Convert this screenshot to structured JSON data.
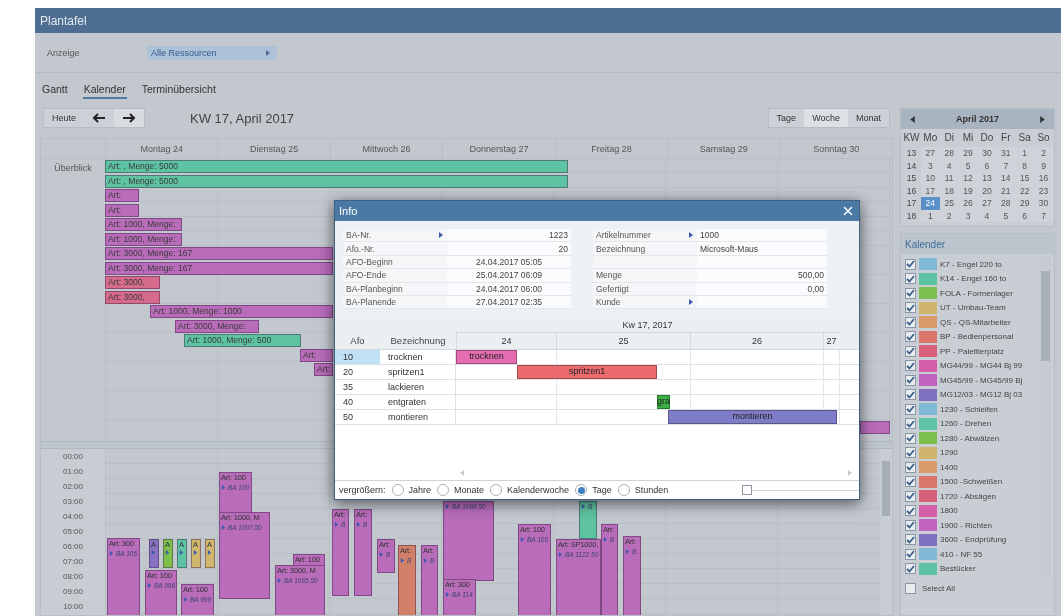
{
  "window": {
    "title": "Plantafel"
  },
  "filter": {
    "label": "Anzeige",
    "value": "Alle Ressourcen"
  },
  "tabs": [
    {
      "label": "Gantt",
      "selected": false
    },
    {
      "label": "Kalender",
      "selected": true
    },
    {
      "label": "Terminübersicht",
      "selected": false
    }
  ],
  "toolbar": {
    "today": "Heute",
    "period": "KW 17, April 2017",
    "views": [
      {
        "label": "Tage",
        "selected": false
      },
      {
        "label": "Woche",
        "selected": true
      },
      {
        "label": "Monat",
        "selected": false
      }
    ]
  },
  "days": [
    "Montag 24",
    "Dienstag 25",
    "Mittwoch 26",
    "Donnerstag 27",
    "Freitag 28",
    "Samstag 29",
    "Sonntag 30"
  ],
  "overview": {
    "label": "Überblick",
    "bars": [
      {
        "label": "Art: , Menge: 5000",
        "color": "#5ec3a2"
      },
      {
        "label": "Art: , Menge: 5000",
        "color": "#5ec3a2"
      },
      {
        "label": "Art:",
        "color": "#b86cba"
      },
      {
        "label": "Art:",
        "color": "#b86cba"
      },
      {
        "label": "Art: 1000, Menge:",
        "color": "#b86cba"
      },
      {
        "label": "Art: 1000, Menge:",
        "color": "#b86cba"
      },
      {
        "label": "Art: 3000, Menge: 167",
        "color": "#b86cba"
      },
      {
        "label": "Art: 3000, Menge: 167",
        "color": "#b86cba"
      },
      {
        "label": "Art: 3000,",
        "color": "#d66a8a"
      },
      {
        "label": "Art: 3000,",
        "color": "#d66a8a"
      },
      {
        "label": "Art: 1000, Menge: 1000",
        "color": "#b86cba"
      },
      {
        "label": "Art: 3000, Menge:",
        "color": "#b86cba"
      },
      {
        "label": "Art: 1000, Menge: 500",
        "color": "#5ec3a2"
      },
      {
        "label": "Art:",
        "color": "#b86cba"
      },
      {
        "label": "Art:",
        "color": "#b86cba"
      },
      {
        "color": "#b86cba"
      }
    ]
  },
  "hours": [
    "00:00",
    "01:00",
    "02:00",
    "03:00",
    "04:00",
    "05:00",
    "06:00",
    "07:00",
    "08:00",
    "09:00",
    "10:00"
  ],
  "events": [
    {
      "title": "Art: 300",
      "ref": "BA 105",
      "linked": true,
      "color": "#b86cba"
    },
    {
      "title": "A",
      "linked": true,
      "color": "#8672c0"
    },
    {
      "title": "A",
      "linked": true,
      "color": "#7cbf4c"
    },
    {
      "title": "A",
      "linked": true,
      "color": "#5ec3a2"
    },
    {
      "title": "A",
      "linked": true,
      "color": "#d0b66c"
    },
    {
      "title": "A",
      "linked": true,
      "color": "#d0b66c"
    },
    {
      "title": "Art: 100",
      "ref": "BA 996",
      "linked": true,
      "color": "#b86cba"
    },
    {
      "title": "Art: 100",
      "ref": "BA 999",
      "linked": true,
      "color": "#b86cba"
    },
    {
      "title": "Art: 100",
      "ref": "BA 100",
      "linked": true,
      "color": "#b86cba"
    },
    {
      "title": "Art: 1000, M",
      "ref": "BA 1007.50",
      "linked": true,
      "color": "#b86cba"
    },
    {
      "title": "Art: 100",
      "color": "#b86cba"
    },
    {
      "title": "Art: 3000, M",
      "ref": "BA 1065.50",
      "linked": true,
      "color": "#b86cba"
    },
    {
      "title": "Art:",
      "ref": "B",
      "linked": true,
      "color": "#b86cba"
    },
    {
      "title": "Art:",
      "ref": "B",
      "linked": true,
      "color": "#b86cba"
    },
    {
      "title": "Art:",
      "ref": "B",
      "linked": true,
      "color": "#b86cba"
    },
    {
      "title": "Art:",
      "ref": "B",
      "linked": true,
      "color": "#d2806a"
    },
    {
      "title": "Art:",
      "ref": "B",
      "linked": true,
      "color": "#b86cba"
    },
    {
      "ref": "BA 1088.50",
      "linked": true,
      "color": "#b86cba"
    },
    {
      "title": "Art: 300",
      "ref": "BA 114",
      "linked": true,
      "color": "#b86cba"
    },
    {
      "title": "Art: 100",
      "ref": "BA 105",
      "linked": true,
      "color": "#b86cba"
    },
    {
      "ref": "B",
      "linked": true,
      "color": "#5ec3a2"
    },
    {
      "title": "Art:",
      "ref": "B",
      "linked": true,
      "color": "#b86cba"
    },
    {
      "title": "Art: SP1000,",
      "ref": "BA 1122.50",
      "linked": true,
      "color": "#b86cba"
    },
    {
      "title": "Art:",
      "ref": "B",
      "linked": true,
      "color": "#b86cba"
    }
  ],
  "mini_calendar": {
    "month": "April 2017",
    "headers": [
      "KW",
      "Mo",
      "Di",
      "Mi",
      "Do",
      "Fr",
      "Sa",
      "So"
    ],
    "weeks": [
      {
        "kw": "13",
        "days": [
          {
            "d": "27",
            "selected": false
          },
          {
            "d": "28",
            "selected": false
          },
          {
            "d": "29",
            "selected": false
          },
          {
            "d": "30",
            "selected": false
          },
          {
            "d": "31",
            "selected": false
          },
          {
            "d": "1",
            "selected": false
          },
          {
            "d": "2",
            "selected": false
          }
        ]
      },
      {
        "kw": "14",
        "days": [
          {
            "d": "3",
            "selected": false
          },
          {
            "d": "4",
            "selected": false
          },
          {
            "d": "5",
            "selected": false
          },
          {
            "d": "6",
            "selected": false
          },
          {
            "d": "7",
            "selected": false
          },
          {
            "d": "8",
            "selected": false
          },
          {
            "d": "9",
            "selected": false
          }
        ]
      },
      {
        "kw": "15",
        "days": [
          {
            "d": "10",
            "selected": false
          },
          {
            "d": "11",
            "selected": false
          },
          {
            "d": "12",
            "selected": false
          },
          {
            "d": "13",
            "selected": false
          },
          {
            "d": "14",
            "selected": false
          },
          {
            "d": "15",
            "selected": false
          },
          {
            "d": "16",
            "selected": false
          }
        ]
      },
      {
        "kw": "16",
        "days": [
          {
            "d": "17",
            "selected": false
          },
          {
            "d": "18",
            "selected": false
          },
          {
            "d": "19",
            "selected": false
          },
          {
            "d": "20",
            "selected": false
          },
          {
            "d": "21",
            "selected": false
          },
          {
            "d": "22",
            "selected": false
          },
          {
            "d": "23",
            "selected": false
          }
        ]
      },
      {
        "kw": "17",
        "days": [
          {
            "d": "24",
            "selected": true
          },
          {
            "d": "25",
            "selected": false
          },
          {
            "d": "26",
            "selected": false
          },
          {
            "d": "27",
            "selected": false
          },
          {
            "d": "28",
            "selected": false
          },
          {
            "d": "29",
            "selected": false
          },
          {
            "d": "30",
            "selected": false
          }
        ]
      },
      {
        "kw": "18",
        "days": [
          {
            "d": "1",
            "selected": false
          },
          {
            "d": "2",
            "selected": false
          },
          {
            "d": "3",
            "selected": false
          },
          {
            "d": "4",
            "selected": false
          },
          {
            "d": "5",
            "selected": false
          },
          {
            "d": "6",
            "selected": false
          },
          {
            "d": "7",
            "selected": false
          }
        ]
      }
    ]
  },
  "calendars": {
    "title": "Kalender",
    "items": [
      {
        "label": "K7 - Engel 220 to",
        "color": "#7fb9d6",
        "checked": true
      },
      {
        "label": "K14 - Engel 160 to",
        "color": "#5ec3a2",
        "checked": true
      },
      {
        "label": "FOLA - Formenlager",
        "color": "#7cbf4c",
        "checked": true
      },
      {
        "label": "UT - Umbau-Team",
        "color": "#d0b66c",
        "checked": true
      },
      {
        "label": "QS - QS-Mitarbeiter",
        "color": "#d99a6c",
        "checked": true
      },
      {
        "label": "BP - Bedienpersonal",
        "color": "#d9756a",
        "checked": true
      },
      {
        "label": "PP - Palettierplatz",
        "color": "#d9607a",
        "checked": true
      },
      {
        "label": "MG44/99 - MG44 Bj 99",
        "color": "#d45fa8",
        "checked": true
      },
      {
        "label": "MG45/99 - MG45/99 Bj",
        "color": "#c064c0",
        "checked": true
      },
      {
        "label": "MG12/03 - MG12 Bj 03",
        "color": "#7f70c0",
        "checked": true
      },
      {
        "label": "1230 - Schleifen",
        "color": "#7fb9d6",
        "checked": true
      },
      {
        "label": "1260 - Drehen",
        "color": "#5ec3a2",
        "checked": true
      },
      {
        "label": "1280 - Abwälzen",
        "color": "#7cbf4c",
        "checked": true
      },
      {
        "label": "1290",
        "color": "#d0b66c",
        "checked": true
      },
      {
        "label": "1400",
        "color": "#d99a6c",
        "checked": true
      },
      {
        "label": "1500 -Schweißen",
        "color": "#d9756a",
        "checked": true
      },
      {
        "label": "1720 - Absägen",
        "color": "#d9607a",
        "checked": true
      },
      {
        "label": "1800",
        "color": "#d45fa8",
        "checked": true
      },
      {
        "label": "1900 - Richten",
        "color": "#c064c0",
        "checked": true
      },
      {
        "label": "3600 - Endprüfung",
        "color": "#7f70c0",
        "checked": true
      },
      {
        "label": "410 - NF 55",
        "color": "#7fb9d6",
        "checked": true
      },
      {
        "label": "Bestücker",
        "color": "#5ec3a2",
        "checked": true
      }
    ],
    "select_all": {
      "label": "Select All",
      "checked": false
    }
  },
  "info_dialog": {
    "title": "Info",
    "left_fields": [
      {
        "label": "BA-Nr.",
        "value": "1223",
        "kind": "number",
        "linked": true
      },
      {
        "label": "Afo.-Nr.",
        "value": "20",
        "kind": "number",
        "linked": false
      },
      {
        "label": "AFO-Beginn",
        "value": "24.04.2017 05:05",
        "kind": "date",
        "linked": false
      },
      {
        "label": "AFO-Ende",
        "value": "25.04.2017 06:09",
        "kind": "date",
        "linked": false
      },
      {
        "label": "BA-Planbeginn",
        "value": "24.04.2017 06:00",
        "kind": "date",
        "linked": false
      },
      {
        "label": "BA-Planende",
        "value": "27.04.2017 02:35",
        "kind": "date",
        "linked": false
      }
    ],
    "right_fields": [
      {
        "label": "Artikelnummer",
        "value": "1000",
        "kind": "text",
        "linked": true
      },
      {
        "label": "Bezeichnung",
        "value": "Microsoft-Maus",
        "kind": "text",
        "linked": false
      },
      {
        "kind": "blank"
      },
      {
        "label": "Menge",
        "value": "500,00",
        "kind": "number",
        "linked": false
      },
      {
        "label": "Gefertigt",
        "value": "0,00",
        "kind": "number",
        "linked": false
      },
      {
        "label": "Kunde",
        "kind": "text",
        "linked": true
      }
    ],
    "gantt": {
      "week": "Kw 17, 2017",
      "columns": [
        "Afo",
        "Bezeichnung"
      ],
      "days": [
        "24",
        "25",
        "26",
        "27"
      ],
      "rows": [
        {
          "afo": "10",
          "name": "trocknen",
          "bar": "trocknen",
          "color": "#e46db2",
          "selected": true
        },
        {
          "afo": "20",
          "name": "spritzen1",
          "bar": "spritzen1",
          "color": "#ea6a6e",
          "selected": false
        },
        {
          "afo": "35",
          "name": "lackieren",
          "selected": false
        },
        {
          "afo": "40",
          "name": "entgraten",
          "bar": "gra",
          "color": "#3cb043",
          "selected": false
        },
        {
          "afo": "50",
          "name": "montieren",
          "bar": "montieren",
          "color": "#7f7cc8",
          "selected": false
        }
      ]
    },
    "zoom": {
      "label": "vergrößern:",
      "options": [
        {
          "label": "Jahre",
          "selected": false
        },
        {
          "label": "Monate",
          "selected": false
        },
        {
          "label": "Kalenderwoche",
          "selected": false
        },
        {
          "label": "Tage",
          "selected": true
        },
        {
          "label": "Stunden",
          "selected": false
        }
      ],
      "slider": {
        "level": 0
      }
    }
  }
}
